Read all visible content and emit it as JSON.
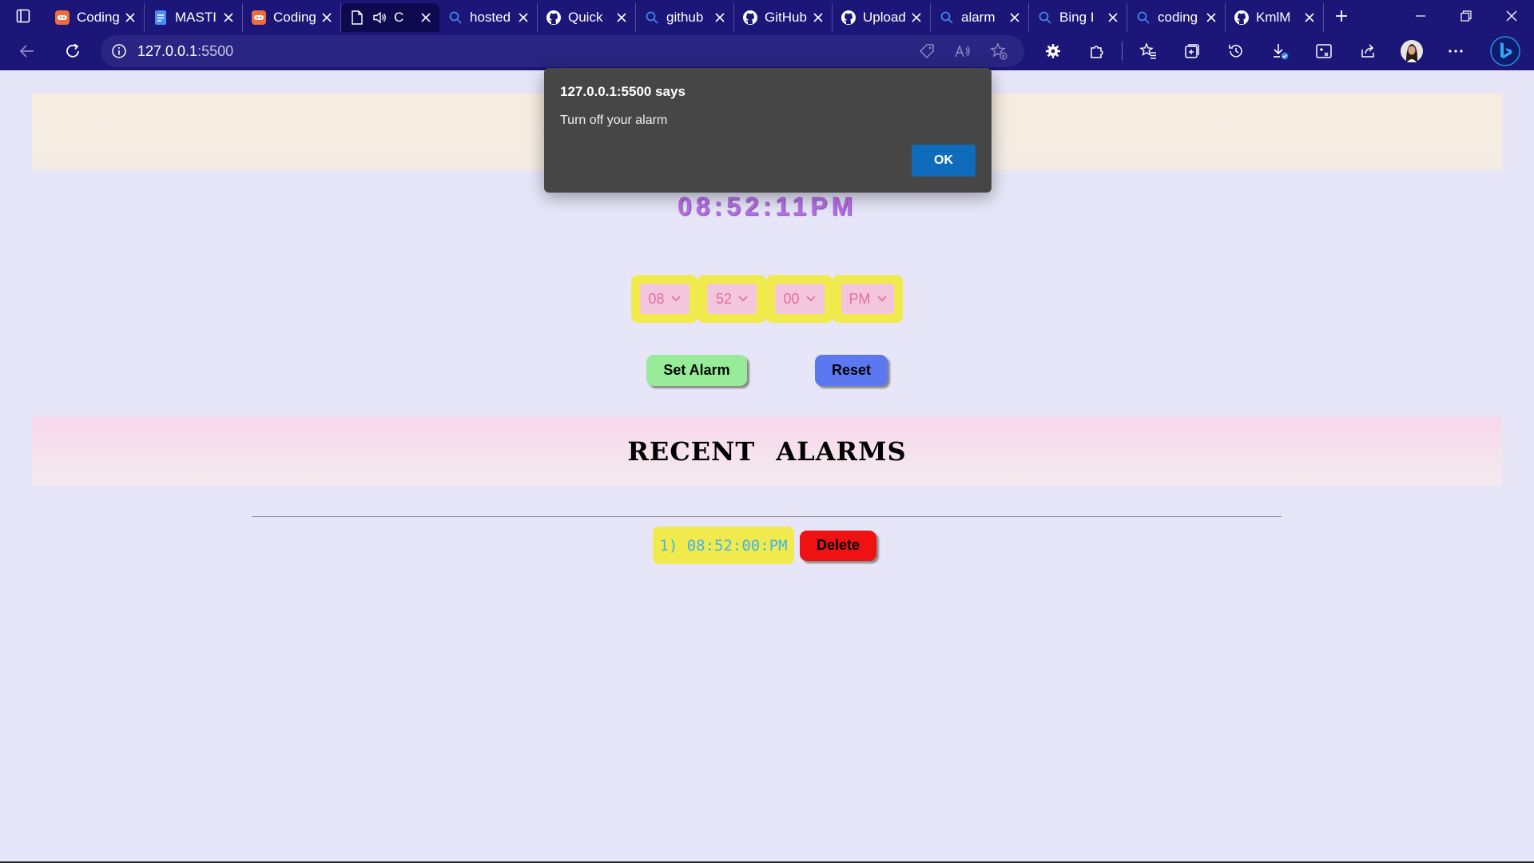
{
  "browser": {
    "tabs": [
      {
        "title": "Coding",
        "icon": "coding-ninjas-icon"
      },
      {
        "title": "MASTI",
        "icon": "docs-icon"
      },
      {
        "title": "Coding",
        "icon": "coding-ninjas-icon"
      },
      {
        "title": "C",
        "icon": "page-icon",
        "active": true
      },
      {
        "title": "hosted",
        "icon": "search-icon"
      },
      {
        "title": "Quick",
        "icon": "github-icon"
      },
      {
        "title": "github",
        "icon": "search-icon"
      },
      {
        "title": "GitHub",
        "icon": "github-icon"
      },
      {
        "title": "Upload",
        "icon": "github-icon"
      },
      {
        "title": "alarm",
        "icon": "search-icon"
      },
      {
        "title": "Bing I",
        "icon": "search-icon"
      },
      {
        "title": "coding",
        "icon": "search-icon"
      },
      {
        "title": "KmlM",
        "icon": "github-icon"
      }
    ],
    "address": {
      "host": "127.0.0.1",
      "port": ":5500"
    }
  },
  "clock": {
    "time": "08:52:11PM"
  },
  "selectors": {
    "hour": "08",
    "minute": "52",
    "second": "00",
    "ampm": "PM"
  },
  "buttons": {
    "set_alarm": "Set Alarm",
    "reset": "Reset",
    "delete": "Delete"
  },
  "recent": {
    "title": "RECENT ALARMS",
    "alarms": [
      {
        "label": "1) 08:52:00:PM"
      }
    ]
  },
  "dialog": {
    "title": "127.0.0.1:5500 says",
    "message": "Turn off your alarm",
    "ok_label": "OK"
  },
  "colors": {
    "browser_chrome": "#1b1678",
    "page_background": "#e6e6f8",
    "clock_text": "#b56fe8",
    "select_frame": "#f0ea4c",
    "set_button": "#98ec99",
    "reset_button": "#5c78f0",
    "delete_button": "#f01212",
    "dialog_ok": "#0f6cbd"
  }
}
